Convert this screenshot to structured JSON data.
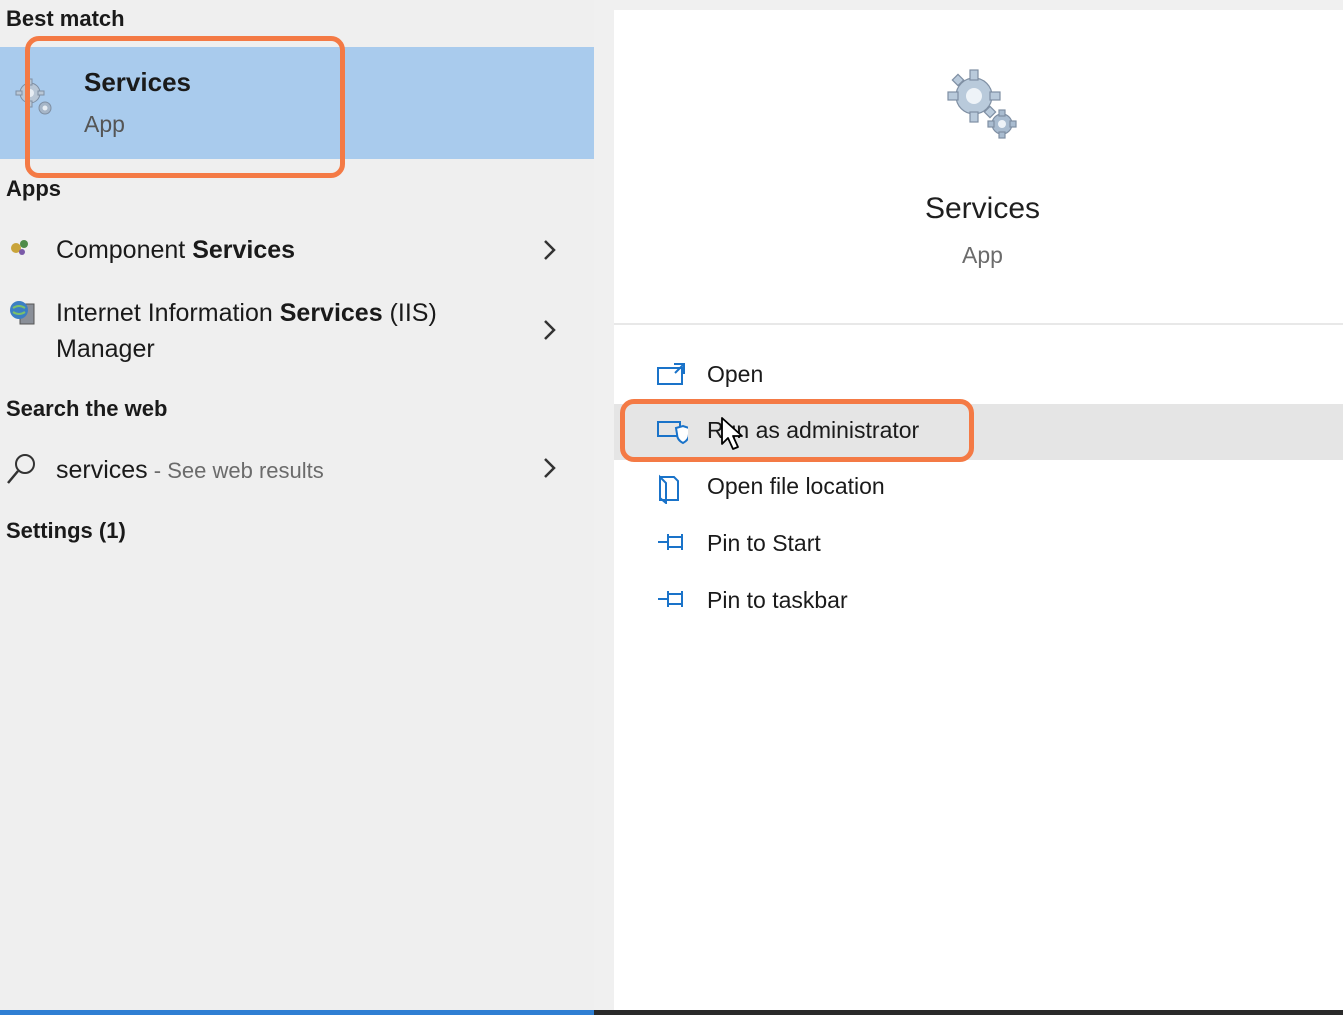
{
  "left": {
    "best_match_header": "Best match",
    "best_match": {
      "name": "Services",
      "type": "App",
      "icon": "gears-icon"
    },
    "apps_header": "Apps",
    "apps": [
      {
        "label_prefix": "Component ",
        "label_bold": "Services",
        "icon": "component-services-icon"
      },
      {
        "label_prefix": "Internet Information ",
        "label_bold": "Services",
        "label_suffix": " (IIS)",
        "label_line2": "Manager",
        "icon": "iis-globe-icon"
      }
    ],
    "web_header": "Search the web",
    "web": {
      "query": "services",
      "separator": " - ",
      "hint": "See web results"
    },
    "settings_header": "Settings (1)"
  },
  "right": {
    "title": "Services",
    "subtitle": "App",
    "actions": [
      {
        "label": "Open",
        "icon": "open-window-icon"
      },
      {
        "label": "Run as administrator",
        "icon": "shield-window-icon"
      },
      {
        "label": "Open file location",
        "icon": "folder-icon"
      },
      {
        "label": "Pin to Start",
        "icon": "pin-icon"
      },
      {
        "label": "Pin to taskbar",
        "icon": "pin-icon"
      }
    ]
  },
  "colors": {
    "selection": "#a9cbed",
    "annotation": "#f47a45",
    "accent": "#2f7fd3"
  }
}
